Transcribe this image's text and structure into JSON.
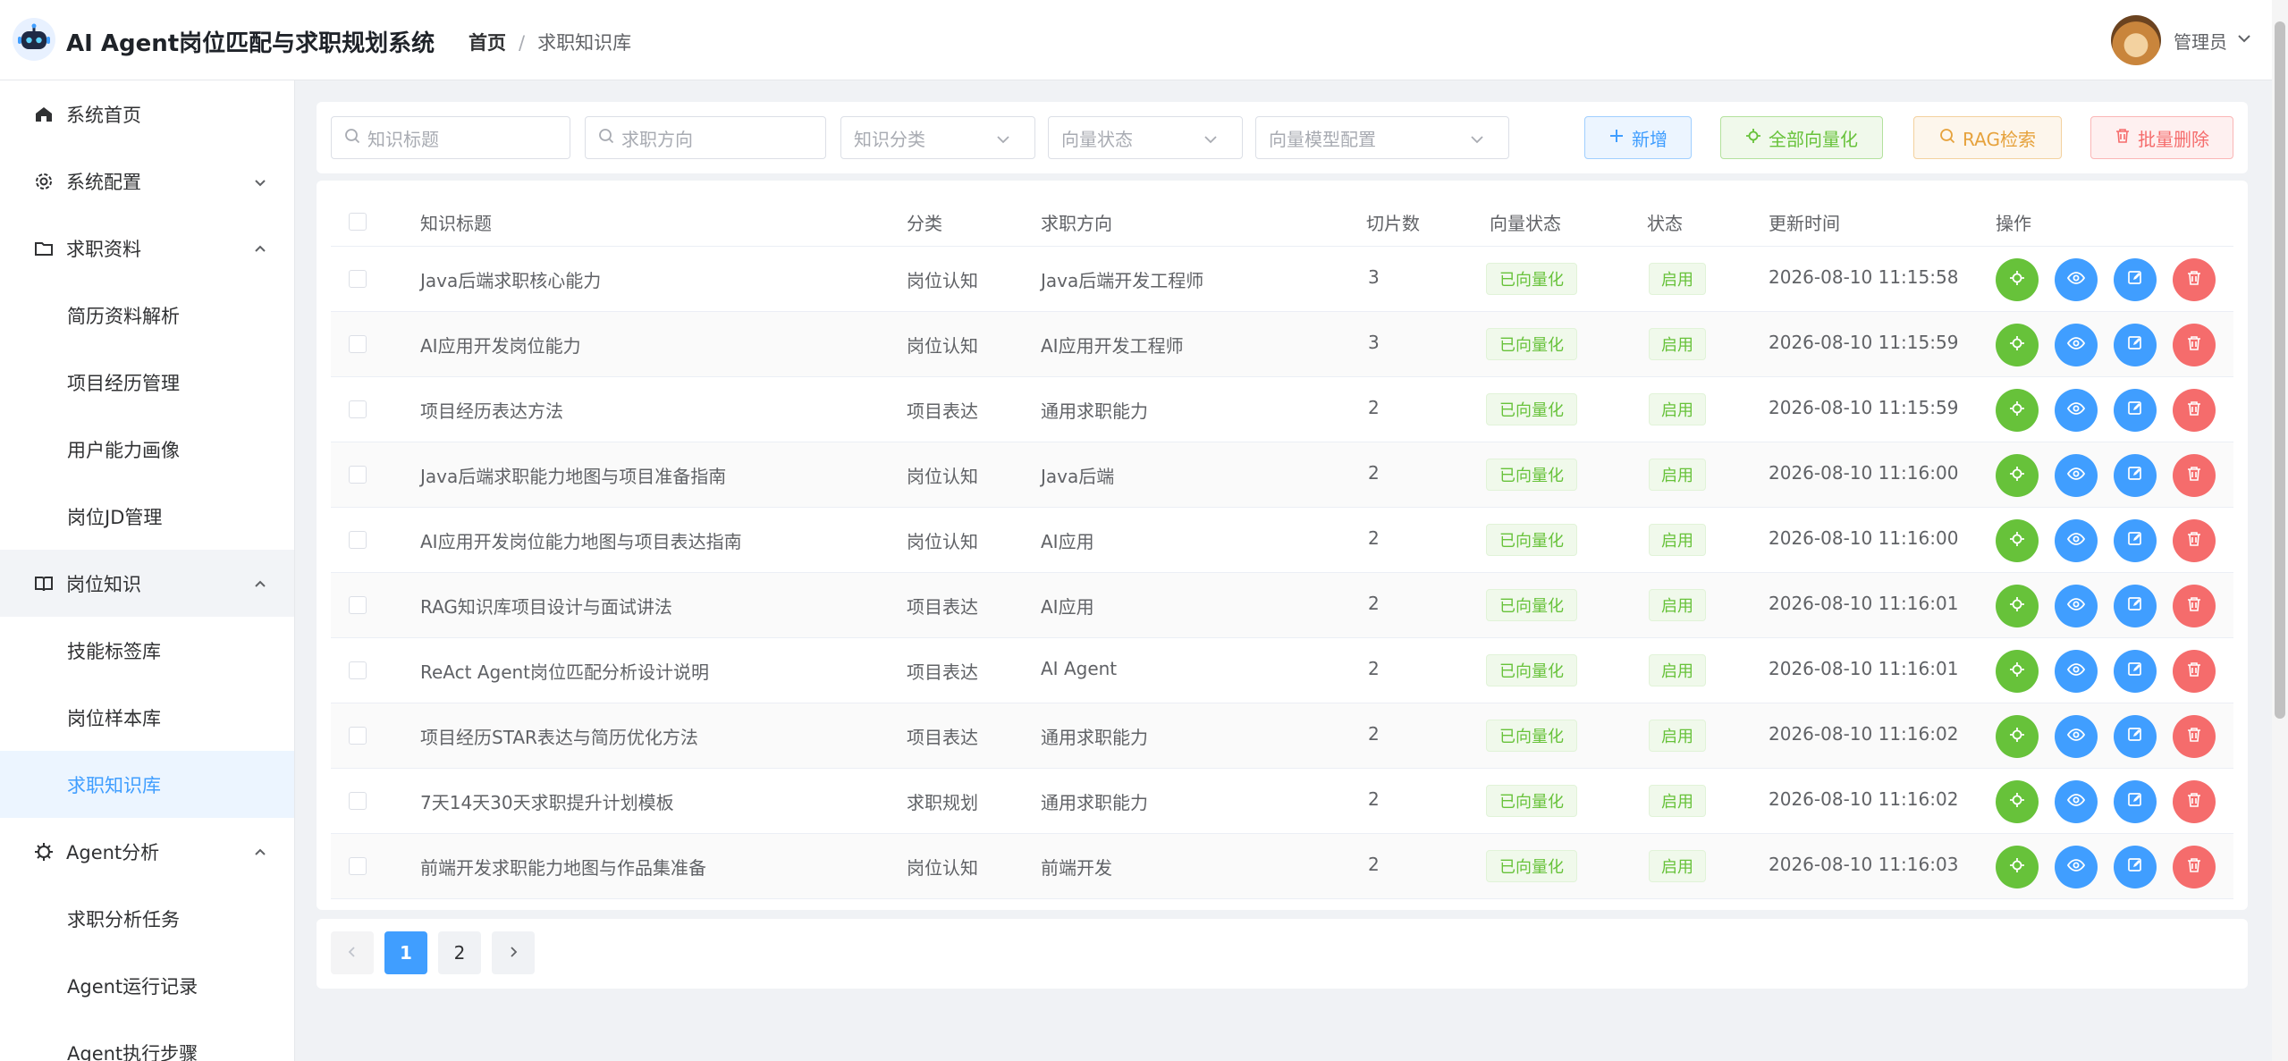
{
  "app": {
    "title": "AI Agent岗位匹配与求职规划系统"
  },
  "breadcrumb": {
    "home": "首页",
    "sep": "/",
    "current": "求职知识库"
  },
  "user": {
    "name": "管理员"
  },
  "sidebar": {
    "items": [
      {
        "label": "系统首页",
        "icon": "home-icon"
      },
      {
        "label": "系统配置",
        "icon": "gear-icon"
      },
      {
        "label": "求职资料",
        "icon": "folder-icon"
      },
      {
        "label": "简历资料解析"
      },
      {
        "label": "项目经历管理"
      },
      {
        "label": "用户能力画像"
      },
      {
        "label": "岗位JD管理"
      },
      {
        "label": "岗位知识",
        "icon": "book-icon"
      },
      {
        "label": "技能标签库"
      },
      {
        "label": "岗位样本库"
      },
      {
        "label": "求职知识库"
      },
      {
        "label": "Agent分析",
        "icon": "chip-icon"
      },
      {
        "label": "求职分析任务"
      },
      {
        "label": "Agent运行记录"
      },
      {
        "label": "Agent执行步骤"
      }
    ]
  },
  "filters": {
    "title_placeholder": "知识标题",
    "direction_placeholder": "求职方向",
    "category_placeholder": "知识分类",
    "vector_status_placeholder": "向量状态",
    "model_placeholder": "向量模型配置"
  },
  "toolbar": {
    "add": "新增",
    "vectorize_all": "全部向量化",
    "rag": "RAG检索",
    "batch_delete": "批量删除"
  },
  "table": {
    "columns": [
      "知识标题",
      "分类",
      "求职方向",
      "切片数",
      "向量状态",
      "状态",
      "更新时间",
      "操作"
    ],
    "rows": [
      {
        "title": "Java后端求职核心能力",
        "category": "岗位认知",
        "direction": "Java后端开发工程师",
        "chunks": "3",
        "vector": "已向量化",
        "status": "启用",
        "updated": "2026-08-10 11:15:58"
      },
      {
        "title": "AI应用开发岗位能力",
        "category": "岗位认知",
        "direction": "AI应用开发工程师",
        "chunks": "3",
        "vector": "已向量化",
        "status": "启用",
        "updated": "2026-08-10 11:15:59"
      },
      {
        "title": "项目经历表达方法",
        "category": "项目表达",
        "direction": "通用求职能力",
        "chunks": "2",
        "vector": "已向量化",
        "status": "启用",
        "updated": "2026-08-10 11:15:59"
      },
      {
        "title": "Java后端求职能力地图与项目准备指南",
        "category": "岗位认知",
        "direction": "Java后端",
        "chunks": "2",
        "vector": "已向量化",
        "status": "启用",
        "updated": "2026-08-10 11:16:00"
      },
      {
        "title": "AI应用开发岗位能力地图与项目表达指南",
        "category": "岗位认知",
        "direction": "AI应用",
        "chunks": "2",
        "vector": "已向量化",
        "status": "启用",
        "updated": "2026-08-10 11:16:00"
      },
      {
        "title": "RAG知识库项目设计与面试讲法",
        "category": "项目表达",
        "direction": "AI应用",
        "chunks": "2",
        "vector": "已向量化",
        "status": "启用",
        "updated": "2026-08-10 11:16:01"
      },
      {
        "title": "ReAct Agent岗位匹配分析设计说明",
        "category": "项目表达",
        "direction": "AI Agent",
        "chunks": "2",
        "vector": "已向量化",
        "status": "启用",
        "updated": "2026-08-10 11:16:01"
      },
      {
        "title": "项目经历STAR表达与简历优化方法",
        "category": "项目表达",
        "direction": "通用求职能力",
        "chunks": "2",
        "vector": "已向量化",
        "status": "启用",
        "updated": "2026-08-10 11:16:02"
      },
      {
        "title": "7天14天30天求职提升计划模板",
        "category": "求职规划",
        "direction": "通用求职能力",
        "chunks": "2",
        "vector": "已向量化",
        "status": "启用",
        "updated": "2026-08-10 11:16:02"
      },
      {
        "title": "前端开发求职能力地图与作品集准备",
        "category": "岗位认知",
        "direction": "前端开发",
        "chunks": "2",
        "vector": "已向量化",
        "status": "启用",
        "updated": "2026-08-10 11:16:03"
      }
    ]
  },
  "pagination": {
    "pages": [
      "1",
      "2"
    ],
    "current": "1"
  },
  "colors": {
    "primary": "#409eff",
    "success": "#67c23a",
    "warning": "#e6a23c",
    "danger": "#f56c6c"
  }
}
